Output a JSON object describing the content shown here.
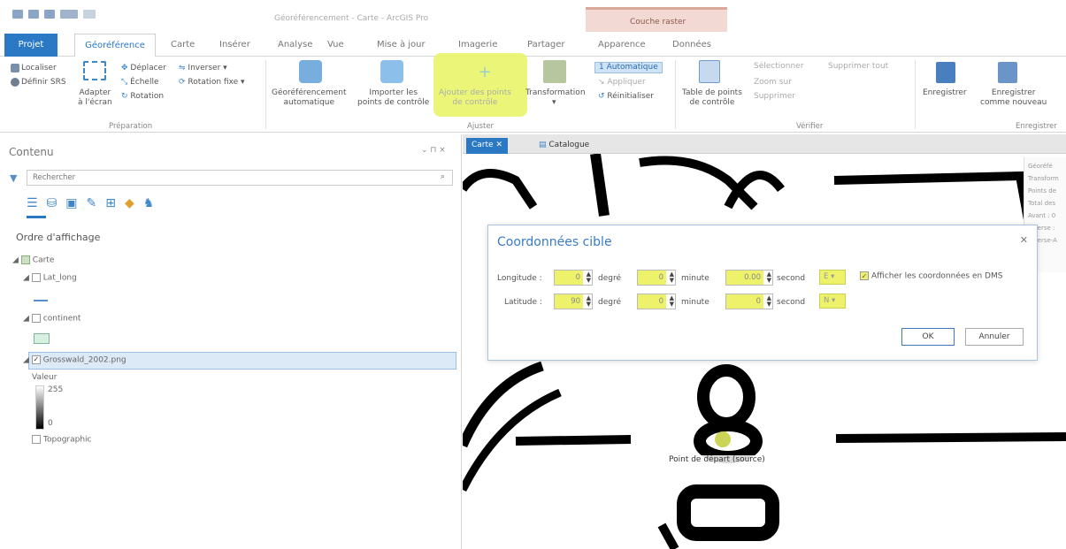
{
  "app": {
    "title": "Géoréférencement - Carte - ArcGIS Pro",
    "context_group": "Couche raster"
  },
  "tabs": [
    "Projet",
    "Géoréférence",
    "Carte",
    "Insérer",
    "Analyse",
    "Vue",
    "Mise à jour",
    "Imagerie",
    "Partager",
    "Apparence",
    "Données"
  ],
  "ribbon": {
    "preparation": {
      "localiser": "Localiser",
      "definir_srs": "Définir SRS",
      "adapter": "Adapter\nà l'écran",
      "deplacer": "Déplacer",
      "echelle": "Échelle",
      "rotation": "Rotation",
      "inverser": "Inverser",
      "rotation_fixe": "Rotation fixe",
      "group_label": "Préparation"
    },
    "ajuster": {
      "georef_auto": "Géoréférencement\nautomatique",
      "importer": "Importer les\npoints de contrôle",
      "ajouter": "Ajouter des points\nde contrôle",
      "transformation": "Transformation",
      "automatique": "1 Automatique",
      "appliquer": "Appliquer",
      "reinitialiser": "Réinitialiser",
      "group_label": "Ajuster"
    },
    "verifier": {
      "table": "Table de points\nde contrôle",
      "selectionner": "Sélectionner",
      "supprimer_tout": "Supprimer tout",
      "zoom": "Zoom sur",
      "supprimer": "Supprimer",
      "group_label": "Vérifier"
    },
    "enregistrer": {
      "enregistrer": "Enregistrer",
      "enregistrer_nouveau": "Enregistrer\ncomme nouveau",
      "group_label": "Enregistrer"
    }
  },
  "contents": {
    "title": "Contenu",
    "controls": "⌄ ⊓ ×",
    "search_placeholder": "Rechercher",
    "ordre": "Ordre d'affichage",
    "layers": {
      "carte": "Carte",
      "lat_long": "Lat_long",
      "continent": "continent",
      "raster": "Grosswald_2002.png",
      "valeur": "Valeur",
      "v255": "255",
      "v0": "0",
      "topographic": "Topographic"
    }
  },
  "map_tabs": {
    "carte": "Carte",
    "catalogue": "Catalogue"
  },
  "right_pane": [
    "Géoréfé",
    "Transform",
    "Points de",
    "Total des",
    "Avant : 0",
    "Inverse : ",
    "Inverse-A"
  ],
  "dialog": {
    "title": "Coordonnées cible",
    "longitude_label": "Longitude :",
    "latitude_label": "Latitude :",
    "lon_deg": "0",
    "lon_min": "0",
    "lon_sec": "0.00",
    "lon_dir": "E",
    "lat_deg": "90",
    "lat_min": "0",
    "lat_sec": "0",
    "lat_dir": "N",
    "degre": "degré",
    "minute": "minute",
    "second": "second",
    "dms_label": "Afficher les coordonnées en DMS",
    "ok": "OK",
    "annuler": "Annuler"
  },
  "map": {
    "start_label": "Point de départ (source)"
  }
}
